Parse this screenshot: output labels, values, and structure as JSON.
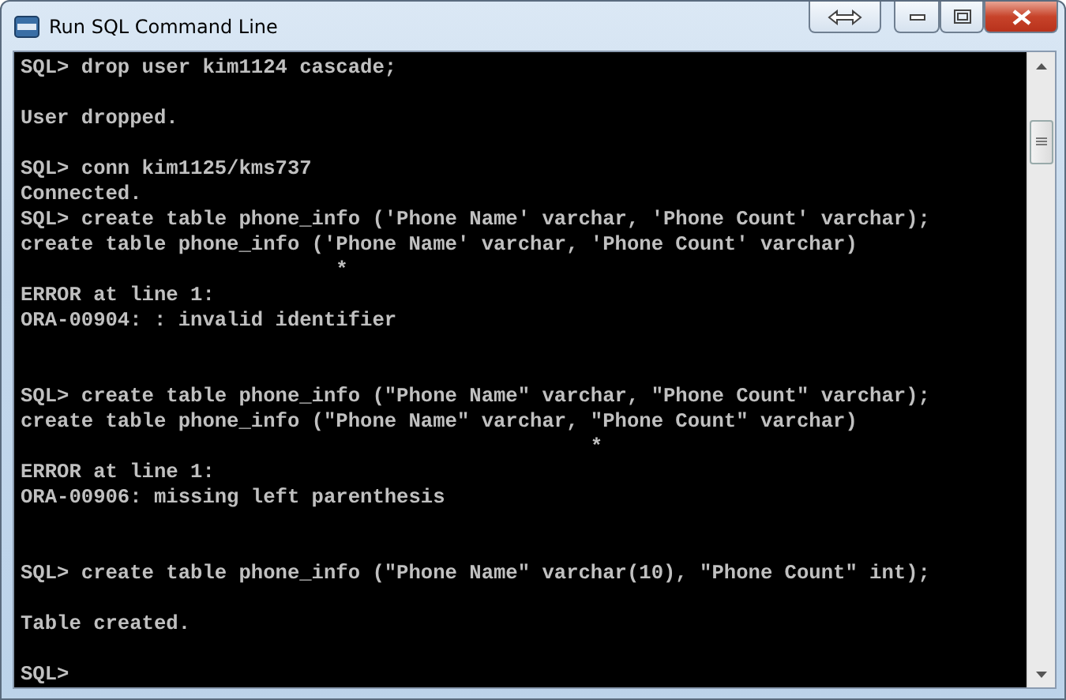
{
  "window": {
    "title": "Run SQL Command Line"
  },
  "console": {
    "lines": [
      {
        "kind": "text",
        "text": "SQL> drop user kim1124 cascade;"
      },
      {
        "kind": "blank"
      },
      {
        "kind": "text",
        "text": "User dropped."
      },
      {
        "kind": "blank"
      },
      {
        "kind": "text",
        "text": "SQL> conn kim1125/kms737"
      },
      {
        "kind": "text",
        "text": "Connected."
      },
      {
        "kind": "text",
        "text": "SQL> create table phone_info ('Phone Name' varchar, 'Phone Count' varchar);"
      },
      {
        "kind": "text",
        "text": "create table phone_info ('Phone Name' varchar, 'Phone Count' varchar)"
      },
      {
        "kind": "text",
        "text": "                          *"
      },
      {
        "kind": "text",
        "text": "ERROR at line 1:"
      },
      {
        "kind": "text",
        "text": "ORA-00904: : invalid identifier"
      },
      {
        "kind": "blank"
      },
      {
        "kind": "blank"
      },
      {
        "kind": "text",
        "text": "SQL> create table phone_info (\"Phone Name\" varchar, \"Phone Count\" varchar);"
      },
      {
        "kind": "text",
        "text": "create table phone_info (\"Phone Name\" varchar, \"Phone Count\" varchar)"
      },
      {
        "kind": "text",
        "text": "                                               *"
      },
      {
        "kind": "text",
        "text": "ERROR at line 1:"
      },
      {
        "kind": "text",
        "text": "ORA-00906: missing left parenthesis"
      },
      {
        "kind": "blank"
      },
      {
        "kind": "blank"
      },
      {
        "kind": "text",
        "text": "SQL> create table phone_info (\"Phone Name\" varchar(10), \"Phone Count\" int);"
      },
      {
        "kind": "blank"
      },
      {
        "kind": "text",
        "text": "Table created."
      },
      {
        "kind": "blank"
      },
      {
        "kind": "text",
        "text": "SQL>"
      }
    ]
  }
}
